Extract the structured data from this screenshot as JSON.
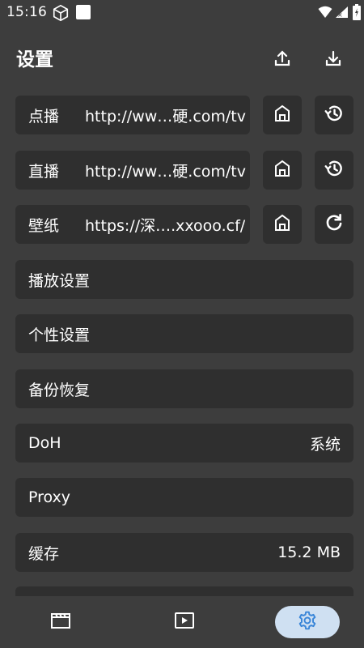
{
  "status_bar": {
    "time": "15:16"
  },
  "header": {
    "title": "设置"
  },
  "sources": [
    {
      "label": "点播",
      "url": "http://ww…硬.com/tv"
    },
    {
      "label": "直播",
      "url": "http://ww…硬.com/tv"
    },
    {
      "label": "壁纸",
      "url": "https://深….xxooo.cf/"
    }
  ],
  "menu": [
    {
      "title": "播放设置",
      "value": ""
    },
    {
      "title": "个性设置",
      "value": ""
    },
    {
      "title": "备份恢复",
      "value": ""
    },
    {
      "title": "DoH",
      "value": "系统"
    },
    {
      "title": "Proxy",
      "value": ""
    },
    {
      "title": "缓存",
      "value": "15.2 MB"
    }
  ],
  "icons": {
    "upload": "upload-icon",
    "download": "download-icon",
    "home": "home-icon",
    "history": "history-icon",
    "refresh": "refresh-icon",
    "nav_vod": "clapperboard-icon",
    "nav_live": "play-icon",
    "nav_settings": "gear-icon"
  },
  "colors": {
    "background": "#3d3d3d",
    "card": "#2f2f2f",
    "active_nav": "#cfe0f2",
    "accent": "#3a86d8"
  },
  "nav": {
    "active": "settings"
  }
}
